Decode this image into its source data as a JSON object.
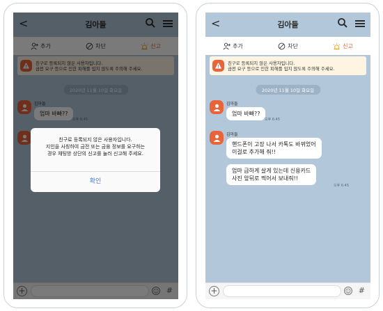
{
  "chat": {
    "title": "김아들",
    "back_glyph": "<",
    "actions": {
      "add": "추가",
      "block": "차단",
      "report": "신고"
    },
    "notice": {
      "line1": "친구로 등록되지 않은 사용자입니다.",
      "line2": "금전 요구 등으로 인한 피해를 입지 않도록 주의해 주세요."
    },
    "date": "2020년 11월 10일 화요일",
    "sender": "김아들",
    "messages": [
      {
        "text": "엄마 바빠??",
        "time": "오후 6:45"
      },
      {
        "text_line1": "핸드폰이 고장 나서 카톡도 바뀌었어",
        "text_line2": "이걸로 추가해 줘!!"
      },
      {
        "text_line1": "엄마 급하게 살게 있는데 신용카드",
        "text_line2": "사진 앞뒤로 찍어서 보내줘!!",
        "time": "오후 6:45"
      }
    ],
    "input": {
      "placeholder": "",
      "plus_glyph": "+",
      "emoji_glyph": "☺",
      "hash_glyph": "#"
    },
    "icons": {
      "back": "chevron-left-icon",
      "search": "search-icon",
      "menu": "menu-icon",
      "add": "add-friend-icon",
      "block": "block-icon",
      "report": "siren-icon",
      "avatar": "profile-placeholder-icon",
      "warning": "warning-icon"
    }
  },
  "dialog": {
    "line1": "친구로 등록되지 않은 사용자입니다.",
    "line2": "지인을 사칭하여 금전 또는 금융 정보를 요구하는",
    "line3": "경우 채팅방 상단의 신고를 눌러 신고해 주세요.",
    "confirm": "확인"
  },
  "colors": {
    "chat_bg": "#b2c7d9",
    "accent_orange": "#e9633b",
    "notice_bg": "#fdf4e2",
    "dialog_button": "#3a7bd5"
  }
}
